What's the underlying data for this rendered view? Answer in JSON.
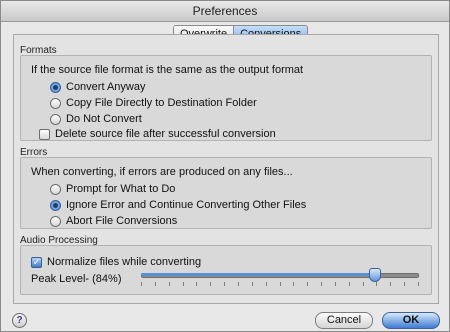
{
  "window": {
    "title": "Preferences"
  },
  "tabs": [
    {
      "label": "Overwrite",
      "active": false
    },
    {
      "label": "Conversions",
      "active": true
    }
  ],
  "formats": {
    "title": "Formats",
    "prompt": "If the source file format is the same as the output format",
    "options": [
      "Convert Anyway",
      "Copy File Directly to Destination Folder",
      "Do Not Convert"
    ],
    "selected": 0,
    "delete_source_label": "Delete source file after successful conversion",
    "delete_source_checked": false
  },
  "errors": {
    "title": "Errors",
    "prompt": "When converting, if errors are produced on any files...",
    "options": [
      "Prompt for What to Do",
      "Ignore Error and Continue Converting Other Files",
      "Abort File Conversions"
    ],
    "selected": 1
  },
  "audio": {
    "title": "Audio Processing",
    "normalize_label": "Normalize files while converting",
    "normalize_checked": true,
    "peak_label": "Peak Level- (84%)",
    "peak_value_percent": 84
  },
  "buttons": {
    "help_label": "?",
    "cancel_label": "Cancel",
    "ok_label": "OK"
  },
  "colors": {
    "accent": "#3e7bd2",
    "selected_tab": "#7fb2ea"
  }
}
